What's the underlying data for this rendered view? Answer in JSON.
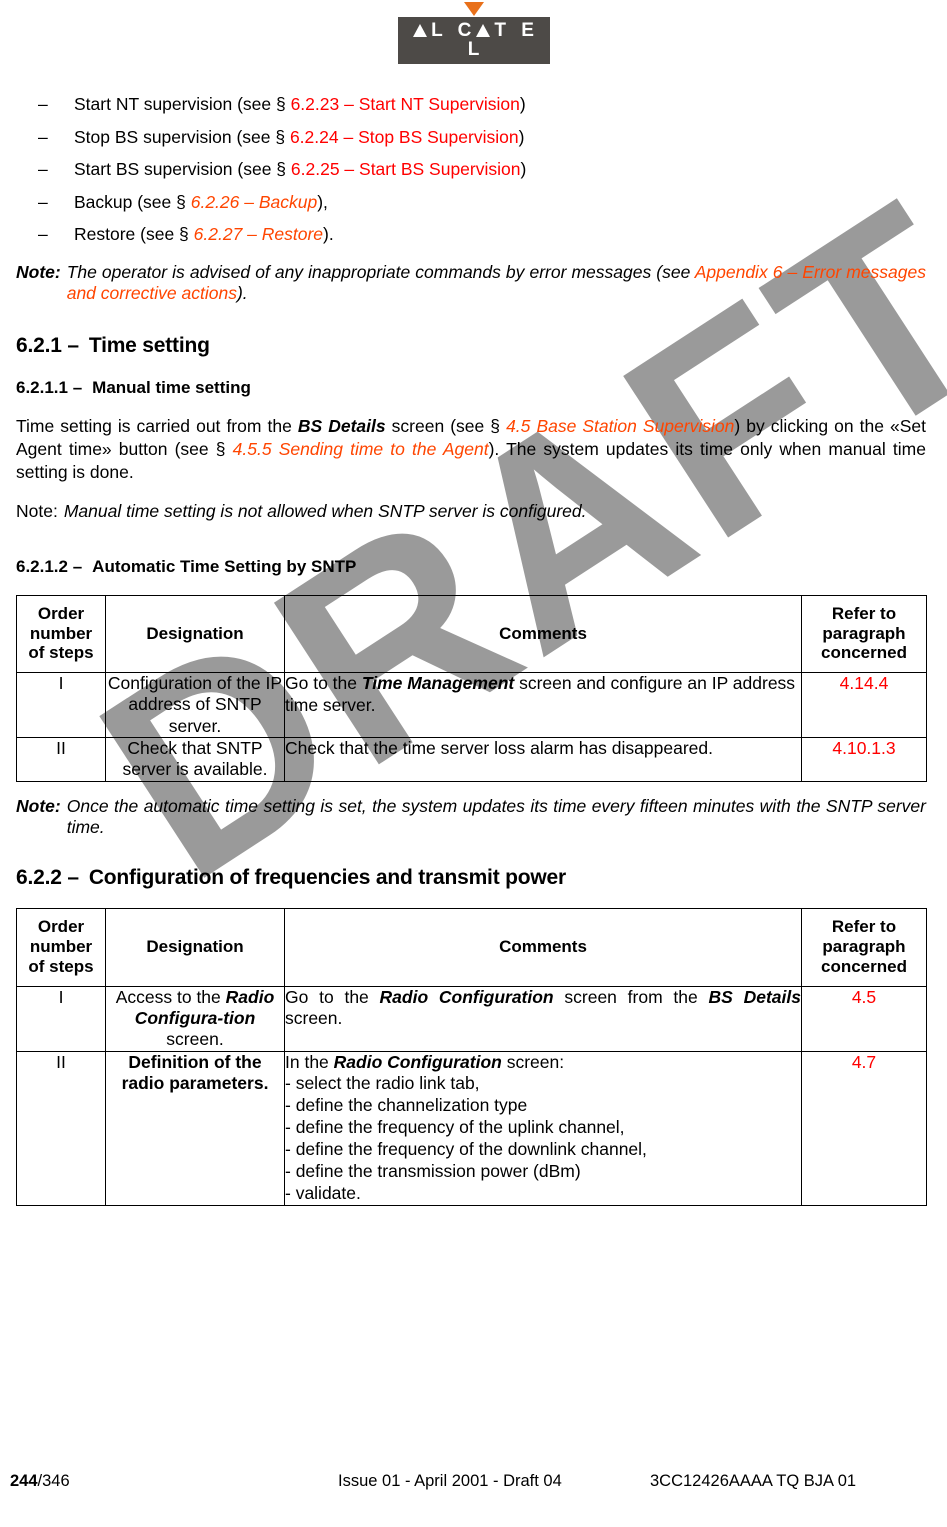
{
  "header": {
    "logo_text": "ALCATEL",
    "logo_letters_pre": "L C",
    "logo_letters_post": "T E L",
    "logo_first_letter": "A"
  },
  "watermark": {
    "text": "DRAFT",
    "color": "#9a9a9a"
  },
  "colors": {
    "xref_red": "#ff0000",
    "xref_orange": "#ff4500",
    "logo_box": "#4d4a47",
    "logo_arrow": "#e8701a"
  },
  "bullets": [
    {
      "dash": "–",
      "lead": "Start NT supervision (see § ",
      "xref": "6.2.23 – Start NT Supervision",
      "tail": ")",
      "style": "red"
    },
    {
      "dash": "–",
      "lead": "Stop BS supervision (see § ",
      "xref": "6.2.24 – Stop BS Supervision",
      "tail": ")",
      "style": "red"
    },
    {
      "dash": "–",
      "lead": "Start BS supervision (see § ",
      "xref": "6.2.25 – Start BS Supervision",
      "tail": ")",
      "style": "red"
    },
    {
      "dash": "–",
      "lead": "Backup (see § ",
      "xref": "6.2.26 – Backup",
      "tail": "),",
      "style": "orange"
    },
    {
      "dash": "–",
      "lead": "Restore (see § ",
      "xref": "6.2.27 – Restore",
      "tail": ").",
      "style": "orange"
    }
  ],
  "note1": {
    "lead": "Note:",
    "body_pre": "The operator is advised of any inappropriate commands by error messages (see ",
    "xref": "Appendix 6 – Error messages and corrective actions",
    "body_post": ")."
  },
  "section_621": {
    "number": "6.2.1 –",
    "title": "Time setting"
  },
  "section_6211": {
    "number": "6.2.1.1 –",
    "title": "Manual time setting"
  },
  "paragraph1": {
    "p1": "Time setting is carried out from the ",
    "bold1": "BS Details",
    "p2": " screen (see § ",
    "xref1": "4.5 Base Station Supervision",
    "p3": ") by clicking on the «Set Agent time» button (see § ",
    "xref2": "4.5.5 Sending time to the Agent",
    "p4": "). The system updates its time only when manual time setting is done."
  },
  "note2": {
    "lead": "Note:",
    "body": "Manual time setting is not allowed when SNTP server is configured."
  },
  "section_6212": {
    "number": "6.2.1.2 –",
    "title": "Automatic Time Setting by SNTP"
  },
  "table1": {
    "headers": {
      "order": "Order number of steps",
      "designation": "Designation",
      "comments": "Comments",
      "refer": "Refer to paragraph concerned"
    },
    "rows": [
      {
        "order": "I",
        "designation": "Configuration of the IP address of SNTP server.",
        "comment_pre": "Go to the ",
        "comment_bold": "Time Management",
        "comment_post": " screen and configure an IP address time server.",
        "refer": "4.14.4"
      },
      {
        "order": "II",
        "designation": "Check that SNTP server is available.",
        "comment_pre": "Check that the time server loss alarm has disappeared.",
        "comment_bold": "",
        "comment_post": "",
        "refer": "4.10.1.3"
      }
    ]
  },
  "note3": {
    "lead": "Note:",
    "body": "Once the automatic time setting is set, the system updates its time every fifteen minutes with the SNTP server time."
  },
  "section_622": {
    "number": "6.2.2 –",
    "title": "Configuration of frequencies and transmit power"
  },
  "table2": {
    "headers": {
      "order": "Order number of steps",
      "designation": "Designation",
      "comments": "Comments",
      "refer": "Refer to paragraph concerned"
    },
    "rows": [
      {
        "order": "I",
        "desig_pre": "Access to the ",
        "desig_bold": "Radio Configura-tion",
        "desig_post": " screen.",
        "comment_pre": "Go to the ",
        "comment_bold1": "Radio Configuration",
        "comment_mid": " screen from the ",
        "comment_bold2": "BS Details",
        "comment_post": " screen.",
        "refer": "4.5"
      },
      {
        "order": "II",
        "desig_bold_full": "Definition of the radio parameters.",
        "comment_pre": "In the ",
        "comment_bold1": "Radio Configuration",
        "comment_post": " screen:",
        "comment_lines": [
          "- select the radio link tab,",
          "- define the channelization type",
          "- define the frequency of the uplink channel,",
          "- define the frequency of the downlink channel,",
          "- define the transmission power (dBm)",
          "- validate."
        ],
        "refer": "4.7"
      }
    ]
  },
  "footer": {
    "page": "244",
    "page_total": "/346",
    "center": "Issue 01 - April 2001 - Draft 04",
    "right": "3CC12426AAAA TQ BJA 01"
  }
}
